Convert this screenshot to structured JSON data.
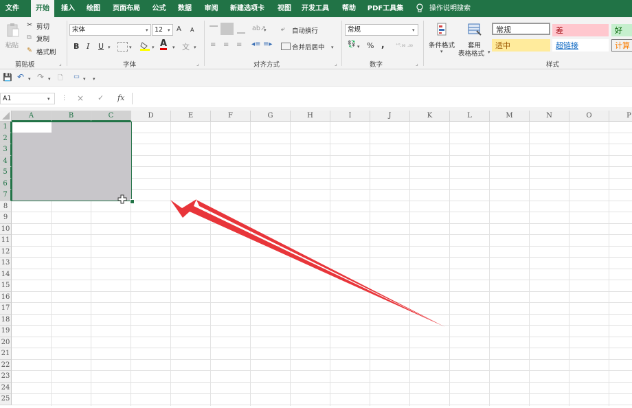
{
  "menu": {
    "tabs": [
      "文件",
      "开始",
      "插入",
      "绘图",
      "页面布局",
      "公式",
      "数据",
      "审阅",
      "新建选项卡",
      "视图",
      "开发工具",
      "帮助",
      "PDF工具集"
    ],
    "active_tab": "开始",
    "tell_me": "操作说明搜索"
  },
  "ribbon": {
    "clipboard": {
      "paste": "粘贴",
      "cut": "剪切",
      "copy": "复制",
      "format_painter": "格式刷",
      "label": "剪贴板"
    },
    "font": {
      "name": "宋体",
      "size": "12",
      "bold": "B",
      "italic": "I",
      "underline": "U",
      "label": "字体",
      "grow": "A",
      "shrink": "A",
      "font_color": "A"
    },
    "alignment": {
      "wrap": "自动换行",
      "merge": "合并后居中",
      "label": "对齐方式"
    },
    "number": {
      "format": "常规",
      "percent": "%",
      "comma": ",",
      "label": "数字"
    },
    "styles": {
      "conditional": "条件格式",
      "table_format_1": "套用",
      "table_format_2": "表格格式",
      "label": "样式",
      "cells": [
        {
          "name": "常规",
          "bg": "#ffffff",
          "fg": "#333333",
          "border": "#9a9a9a"
        },
        {
          "name": "差",
          "bg": "#ffc7ce",
          "fg": "#9c0006",
          "border": "#ffc7ce"
        },
        {
          "name": "好",
          "bg": "#c6efce",
          "fg": "#006100",
          "border": "#c6efce"
        },
        {
          "name": "适中",
          "bg": "#ffeb9c",
          "fg": "#9c5700",
          "border": "#ffeb9c"
        },
        {
          "name": "超链接",
          "bg": "#ffffff",
          "fg": "#0563c1",
          "border": "#ffffff"
        },
        {
          "name": "计算",
          "bg": "#f2f2f2",
          "fg": "#fa7d00",
          "border": "#7f7f7f"
        }
      ]
    }
  },
  "formula_bar": {
    "name_box": "A1",
    "fx": "fx",
    "cancel": "×",
    "enter": "✓",
    "value": ""
  },
  "grid": {
    "columns": [
      "A",
      "B",
      "C",
      "D",
      "E",
      "F",
      "G",
      "H",
      "I",
      "J",
      "K",
      "L",
      "M",
      "N",
      "O",
      "P"
    ],
    "rows": [
      "1",
      "2",
      "3",
      "4",
      "5",
      "6",
      "7",
      "8",
      "9",
      "10",
      "11",
      "12",
      "13",
      "14",
      "15",
      "16",
      "17",
      "18",
      "19",
      "20",
      "21",
      "22",
      "23",
      "24",
      "25"
    ],
    "selection": "A1:C7",
    "selection_color": "#c8c6ca",
    "accent": "#217346",
    "arrow_color": "#e8353a"
  }
}
